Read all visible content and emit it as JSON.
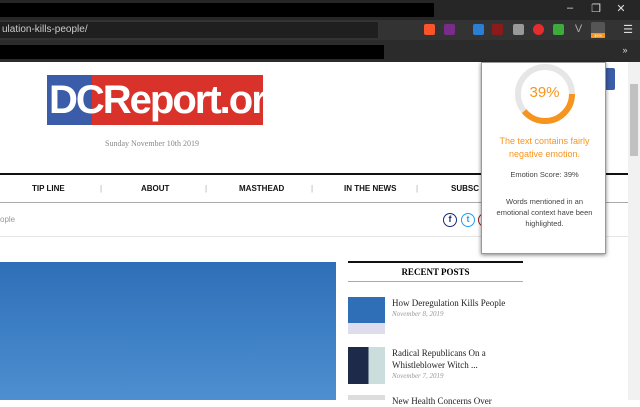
{
  "browser": {
    "url": "ulation-kills-people/",
    "minimize": "–",
    "maximize": "❐",
    "close": "✕",
    "menu": "☰",
    "overflow": "»",
    "extension_badge": "39%"
  },
  "site": {
    "logo": "DCReport.org",
    "date": "Sunday November 10th 2019",
    "nav": [
      "TIP LINE",
      "ABOUT",
      "MASTHEAD",
      "IN THE NEWS",
      "SUBSC"
    ],
    "breadcrumb": "ople",
    "recent_posts_title": "RECENT POSTS",
    "posts": [
      {
        "title": "How Deregulation Kills People",
        "date": "November 8, 2019"
      },
      {
        "title": "Radical Republicans On a Whistleblower Witch ...",
        "date": "November 7, 2019"
      },
      {
        "title": "New Health Concerns Over",
        "date": ""
      }
    ]
  },
  "popup": {
    "percent": "39%",
    "score_value": 0.39,
    "message": "The text contains fairly negative emotion.",
    "score": "Emotion Score: 39%",
    "note": "Words mentioned in an emotional context have been highlighted.",
    "accent": "#f7941d"
  }
}
